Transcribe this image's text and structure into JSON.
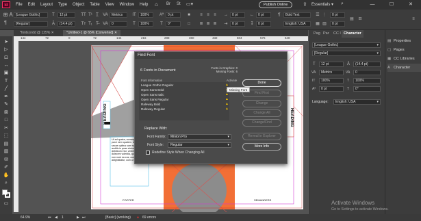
{
  "menubar": {
    "logo": "Id",
    "items": [
      "File",
      "Edit",
      "Layout",
      "Type",
      "Object",
      "Table",
      "View",
      "Window",
      "Help"
    ],
    "publish_label": "Publish Online",
    "workspace_label": "Essentials",
    "win_min": "—",
    "win_max": "☐",
    "win_close": "✕"
  },
  "controlbar": {
    "x_label": "X:",
    "y_label": "Y:",
    "x_value": "",
    "y_value": "",
    "font_family": "[League Gothic]",
    "font_style": "[Regular]",
    "font_size": "12 pt",
    "leading": "(14.4 pt)",
    "kerning": "Metrics",
    "tracking": "0",
    "style_value": "Bold Text",
    "language": "English: USA",
    "percent": "100%",
    "zero1": "0 pt",
    "zero2": "0°"
  },
  "doc_tabs": [
    {
      "label": "*fonts.indd @ 125%",
      "active": false
    },
    {
      "label": "*Untitled-1 @ 65% [Converted]",
      "active": true
    }
  ],
  "ruler": [
    "144",
    "72",
    "0",
    "72",
    "144",
    "216",
    "288",
    "360",
    "432",
    "504",
    "576",
    "648"
  ],
  "canvas": {
    "heading_vertical": "HEADING",
    "footer_left": "FOOTER",
    "footer_right": "SEMANDERS",
    "body_text": "Ut ad quatur, consequis non parci nem quatem. Uptatus cum secae quibus sam sam veles anditis is quas eictorum qui debiteum etur, velentia nus, sam dolecem volestia, qui ullorion non nost ea cus, cus adignistiatur, cum ut latetur.",
    "heading_right": "HEADING"
  },
  "find_font": {
    "title": "Find Font",
    "count_label": "6 Fonts in Document",
    "graphics_label": "Fonts in Graphics: 0",
    "missing_label": "Missing Fonts: 6",
    "col_font": "Font Information",
    "col_activate": "Activate",
    "fonts": [
      "League Gothic Regular",
      "Open Sans Bold",
      "Open Sans Italic",
      "Open Sans Regular",
      "Raleway Bold",
      "Raleway Regular"
    ],
    "tooltip": "Missing Font",
    "replace_with": "Replace With:",
    "family_label": "Font Family:",
    "family_value": "Minion Pro",
    "style_label": "Font Style:",
    "style_value": "Regular",
    "redefine_label": "Redefine Style When Changing All",
    "buttons": {
      "done": "Done",
      "find_first": "Find First",
      "change": "Change",
      "change_all": "Change All",
      "change_find": "Change/Find",
      "reveal": "Reveal in Explorer",
      "more_info": "More Info"
    }
  },
  "char_panel": {
    "tabs": [
      "Pag",
      "Par",
      "CC l",
      "Character"
    ],
    "font_family": "[League Gothic]",
    "font_style": "[Regular]",
    "size": "12 pt",
    "leading": "(14.4 pt)",
    "kerning": "Metrics",
    "tracking": "0",
    "scale_v": "100%",
    "scale_h": "100%",
    "baseline": "0 pt",
    "skew": "0°",
    "language_label": "Language:",
    "language": "English: USA"
  },
  "dock": [
    {
      "icon": "properties-icon",
      "label": "Properties"
    },
    {
      "icon": "pages-icon",
      "label": "Pages"
    },
    {
      "icon": "cc-libraries-icon",
      "label": "CC Libraries"
    },
    {
      "icon": "character-icon",
      "label": "Character"
    }
  ],
  "statusbar": {
    "zoom": "64.9%",
    "page": "1",
    "master": "[Basic] (working)",
    "errors": "69 errors"
  },
  "watermark": {
    "title": "Activate Windows",
    "subtitle": "Go to Settings to activate Windows."
  }
}
